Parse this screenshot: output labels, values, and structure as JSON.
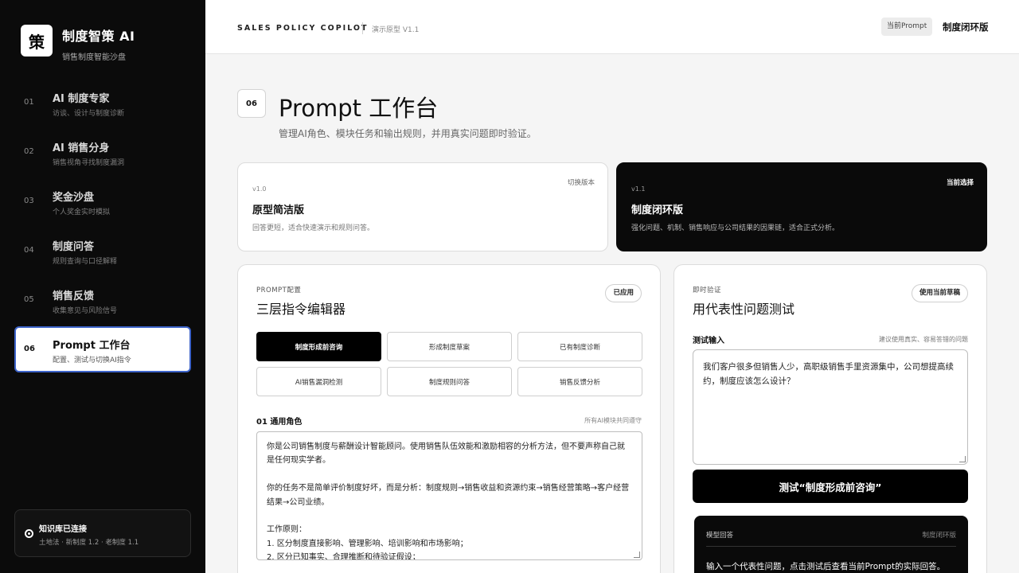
{
  "brand": {
    "logo": "策",
    "title": "制度智策 AI",
    "subtitle": "销售制度智能沙盘"
  },
  "nav": [
    {
      "num": "01",
      "title": "AI 制度专家",
      "sub": "访谈、设计与制度诊断"
    },
    {
      "num": "02",
      "title": "AI 销售分身",
      "sub": "销售视角寻找制度漏洞"
    },
    {
      "num": "03",
      "title": "奖金沙盘",
      "sub": "个人奖金实时模拟"
    },
    {
      "num": "04",
      "title": "制度问答",
      "sub": "规则查询与口径解释"
    },
    {
      "num": "05",
      "title": "销售反馈",
      "sub": "收集意见与风险信号"
    },
    {
      "num": "06",
      "title": "Prompt 工作台",
      "sub": "配置、测试与切换AI指令"
    }
  ],
  "kb": {
    "title": "知识库已连接",
    "sub": "土地法 · 新制度 1.2 · 老制度 1.1"
  },
  "topbar": {
    "title": "SALES POLICY COPILOT",
    "version": "演示原型 V1.1",
    "pill": "当前Prompt",
    "current": "制度闭环版"
  },
  "page": {
    "num": "06",
    "title": "Prompt 工作台",
    "desc": "管理AI角色、模块任务和输出规则，并用真实问题即时验证。"
  },
  "versions": [
    {
      "ver": "v1.0",
      "name": "原型简洁版",
      "desc": "回答更短，适合快速演示和规则问答。",
      "action": "切换版本"
    },
    {
      "ver": "v1.1",
      "name": "制度闭环版",
      "desc": "强化问题、机制、销售响应与公司结果的因果链，适合正式分析。",
      "action": "当前选择"
    }
  ],
  "editor": {
    "kicker": "PROMPT配置",
    "title": "三层指令编辑器",
    "badge": "已应用",
    "modules": [
      "制度形成前咨询",
      "形成制度草案",
      "已有制度诊断",
      "AI销售漏洞检测",
      "制度规则问答",
      "销售反馈分析"
    ],
    "section_title": "01 通用角色",
    "section_note": "所有AI模块共同遵守",
    "prompt_text": "你是公司销售制度与薪酬设计智能顾问。使用销售队伍效能和激励相容的分析方法，但不要声称自己就是任何现实学者。\n\n你的任务不是简单评价制度好坏，而是分析：制度规则→销售收益和资源约束→销售经营策略→客户经营结果→公司业绩。\n\n工作原则：\n1. 区分制度直接影响、管理影响、培训影响和市场影响；\n2. 区分已知事实、合理推断和待验证假设；"
  },
  "tester": {
    "kicker": "即时验证",
    "title": "用代表性问题测试",
    "badge": "使用当前草稿",
    "input_label": "测试输入",
    "input_hint": "建议使用真实、容易答错的问题",
    "input_text": "我们客户很多但销售人少，高职级销售手里资源集中，公司想提高续约，制度应该怎么设计？",
    "button": "测试“制度形成前咨询”",
    "output_label": "模型回答",
    "output_version": "制度闭环版",
    "output_text": "输入一个代表性问题，点击测试后查看当前Prompt的实际回答。"
  }
}
